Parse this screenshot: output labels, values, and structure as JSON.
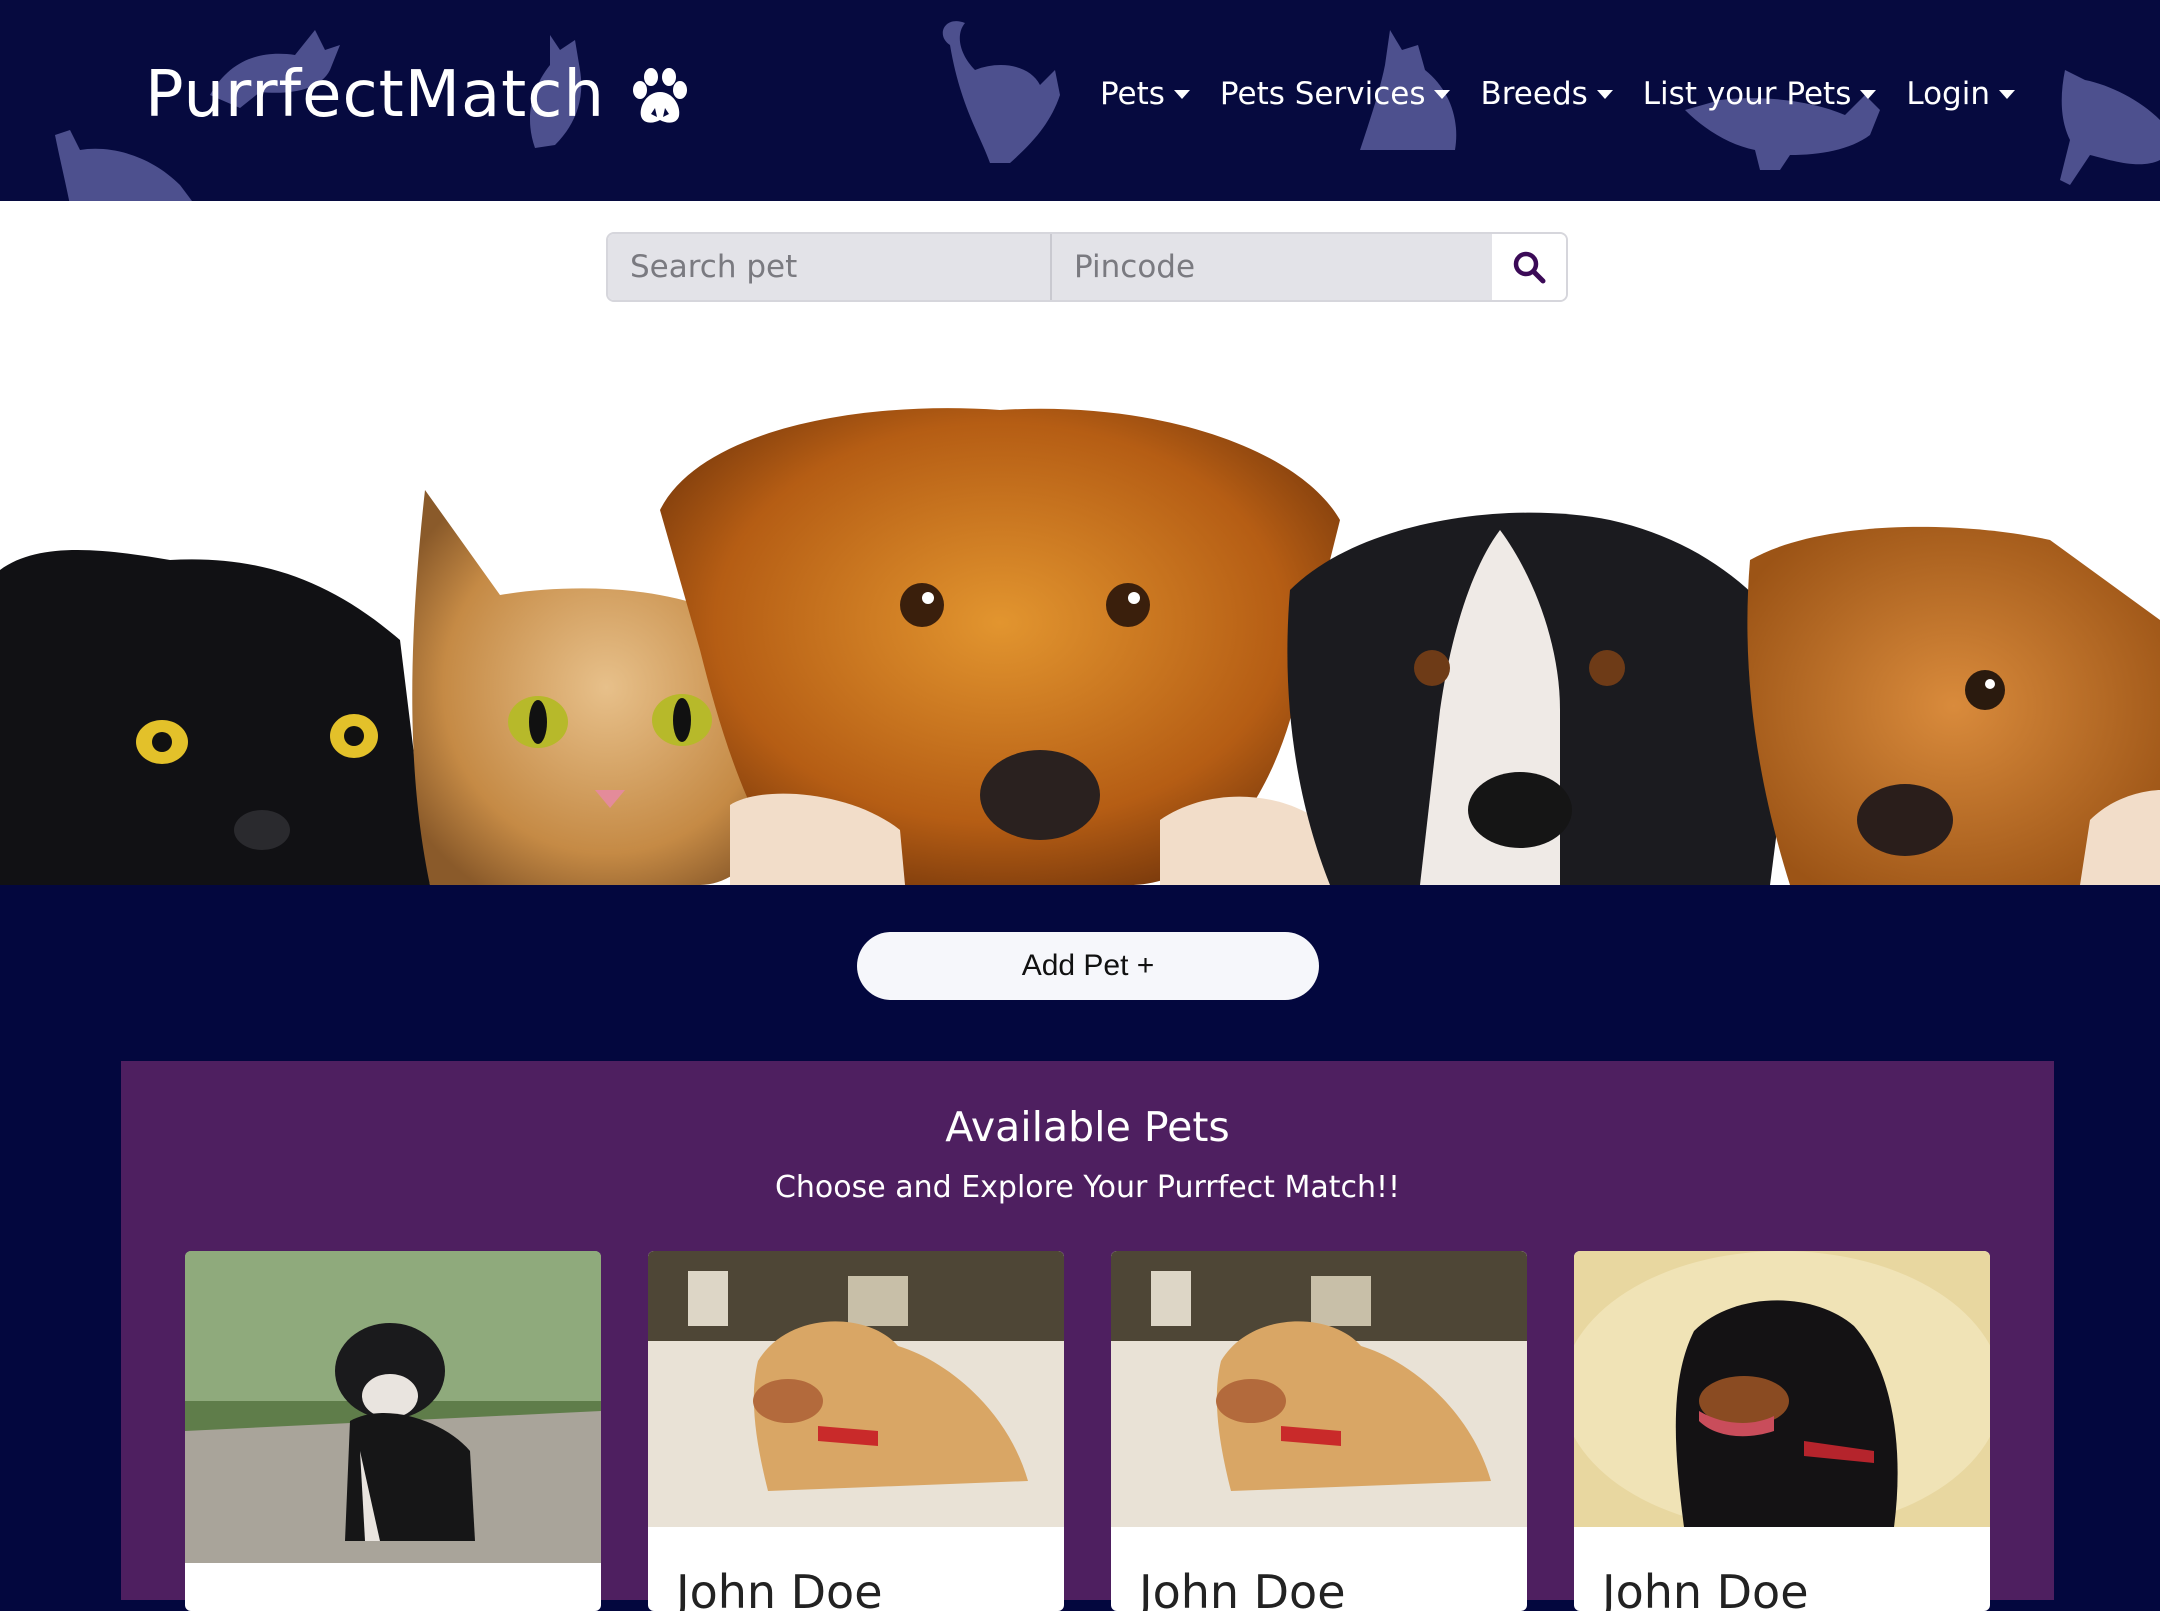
{
  "brand": {
    "name": "PurrfectMatch",
    "icon": "paw-icon"
  },
  "nav": {
    "items": [
      {
        "label": "Pets"
      },
      {
        "label": "Pets Services"
      },
      {
        "label": "Breeds"
      },
      {
        "label": "List your Pets"
      },
      {
        "label": "Login"
      }
    ]
  },
  "search": {
    "pet_placeholder": "Search pet",
    "pincode_placeholder": "Pincode",
    "button_icon": "search-icon"
  },
  "hero": {
    "image": "cats-and-dogs-peeking-banner"
  },
  "add_pet": {
    "label": "Add Pet +"
  },
  "available": {
    "title": "Available Pets",
    "subtitle": "Choose and Explore Your Purrfect Match!!",
    "cards": [
      {
        "name": "",
        "image": "tricolor-puppy-outdoors"
      },
      {
        "name": "John Doe",
        "image": "golden-puppy-red-collar"
      },
      {
        "name": "John Doe",
        "image": "golden-puppy-red-collar"
      },
      {
        "name": "John Doe",
        "image": "rottweiler-lying-down"
      }
    ]
  },
  "colors": {
    "navbar": "#060a3f",
    "page_bg": "#03073e",
    "section_purple": "#4e1f60",
    "accent_search": "#3b0a57"
  }
}
